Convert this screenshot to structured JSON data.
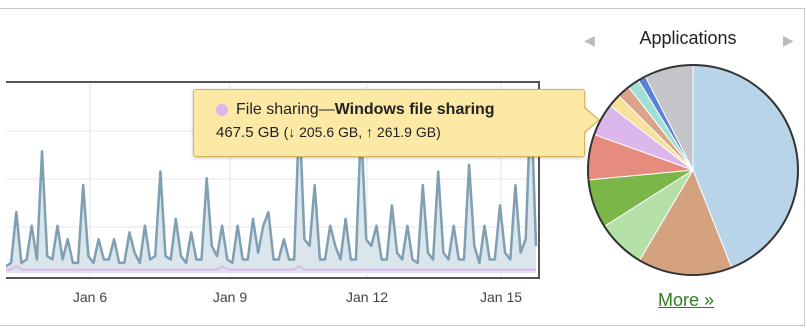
{
  "applications": {
    "title": "Applications",
    "prev_icon": "triangle-left-icon",
    "next_icon": "triangle-right-icon",
    "more_label": "More »",
    "pie_slices": [
      {
        "value": 44.0,
        "color": "#b8d4e8"
      },
      {
        "value": 14.5,
        "color": "#d4a27f"
      },
      {
        "value": 7.5,
        "color": "#b5e0a8"
      },
      {
        "value": 7.5,
        "color": "#7ab648"
      },
      {
        "value": 7.0,
        "color": "#e58c7e"
      },
      {
        "value": 5.0,
        "color": "#dcb7ec"
      },
      {
        "value": 2.0,
        "color": "#f6e29a"
      },
      {
        "value": 2.0,
        "color": "#d9a489"
      },
      {
        "value": 1.8,
        "color": "#9fe0d5"
      },
      {
        "value": 1.2,
        "color": "#5b82d8"
      },
      {
        "value": 7.5,
        "color": "#c4c5cb"
      }
    ]
  },
  "tooltip": {
    "swatch_color": "#dcb7ec",
    "category": "File sharing",
    "separator": "—",
    "title": "Windows file sharing",
    "total": "467.5 GB",
    "breakdown": "(↓ 205.6 GB, ↑ 261.9 GB)"
  },
  "chart_data": {
    "type": "area",
    "x_tick_labels": [
      "Jan 6",
      "Jan 9",
      "Jan 12",
      "Jan 15"
    ],
    "series": [
      {
        "color": "#7f9fb3",
        "values": [
          2,
          3,
          18,
          3,
          4,
          14,
          4,
          36,
          5,
          4,
          14,
          4,
          10,
          3,
          3,
          26,
          5,
          3,
          10,
          4,
          4,
          10,
          3,
          3,
          12,
          6,
          3,
          14,
          4,
          5,
          30,
          5,
          4,
          16,
          5,
          3,
          12,
          4,
          4,
          28,
          8,
          5,
          14,
          4,
          3,
          14,
          4,
          4,
          16,
          6,
          14,
          18,
          4,
          4,
          10,
          4,
          4,
          48,
          10,
          8,
          26,
          4,
          4,
          14,
          8,
          4,
          16,
          4,
          4,
          44,
          10,
          8,
          14,
          4,
          4,
          20,
          6,
          4,
          14,
          4,
          3,
          26,
          6,
          4,
          30,
          6,
          4,
          14,
          4,
          4,
          32,
          8,
          3,
          14,
          4,
          4,
          20,
          6,
          4,
          26,
          6,
          10,
          52,
          8
        ]
      },
      {
        "color": "#dcb7ec",
        "values": [
          1,
          1,
          2,
          1,
          1,
          1,
          1,
          1,
          1,
          1,
          1,
          1,
          1,
          1,
          1,
          1,
          1,
          1,
          1,
          1,
          1,
          1,
          1,
          1,
          1,
          1,
          1,
          1,
          1,
          1,
          1,
          1,
          1,
          1,
          1,
          1,
          1,
          1,
          1,
          1,
          1,
          1,
          2,
          1,
          1,
          1,
          1,
          1,
          1,
          1,
          1,
          1,
          1,
          1,
          1,
          1,
          1,
          2,
          1,
          1,
          1,
          1,
          1,
          1,
          1,
          1,
          1,
          1,
          1,
          1,
          1,
          1,
          1,
          1,
          1,
          1,
          1,
          1,
          1,
          1,
          1,
          1,
          1,
          1,
          1,
          1,
          1,
          1,
          1,
          1,
          1,
          1,
          1,
          1,
          1,
          1,
          1,
          1,
          1,
          1,
          1,
          1,
          1,
          1
        ]
      }
    ],
    "ylim": [
      0,
      55
    ],
    "grid": true
  }
}
